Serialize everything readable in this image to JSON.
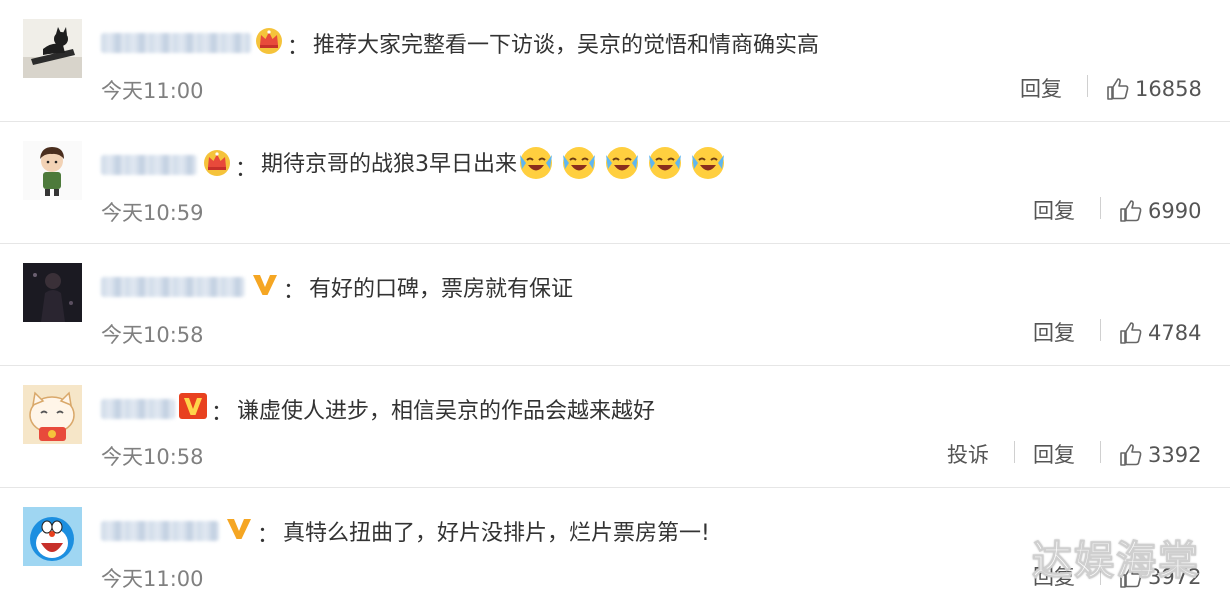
{
  "comments": [
    {
      "text": "推荐大家完整看一下访谈，吴京的觉悟和情商确实高",
      "time": "今天11:00",
      "reply_label": "回复",
      "likes": "16858",
      "badge": "crown-icon"
    },
    {
      "text": "期待京哥的战狼3早日出来",
      "emojis": [
        "crying-laughing-emoji",
        "crying-laughing-emoji",
        "crying-laughing-emoji",
        "crying-laughing-emoji",
        "crying-laughing-emoji"
      ],
      "time": "今天10:59",
      "reply_label": "回复",
      "likes": "6990",
      "badge": "crown-icon"
    },
    {
      "text": "有好的口碑，票房就有保证",
      "time": "今天10:58",
      "reply_label": "回复",
      "likes": "4784",
      "badge": "v-verified-icon"
    },
    {
      "text": "谦虚使人进步，相信吴京的作品会越来越好",
      "time": "今天10:58",
      "report_label": "投诉",
      "reply_label": "回复",
      "likes": "3392",
      "badge": "v-boxed-icon"
    },
    {
      "text": "真特么扭曲了，好片没排片，烂片票房第一!",
      "time": "今天11:00",
      "reply_label": "回复",
      "likes": "3972",
      "badge": "v-verified-icon"
    }
  ],
  "colon": "：",
  "watermark": "达娱海棠",
  "colors": {
    "badge_gold": "#f5a623",
    "badge_red": "#e8411f",
    "time_gray": "#808080",
    "divider": "#e6e6e6"
  }
}
